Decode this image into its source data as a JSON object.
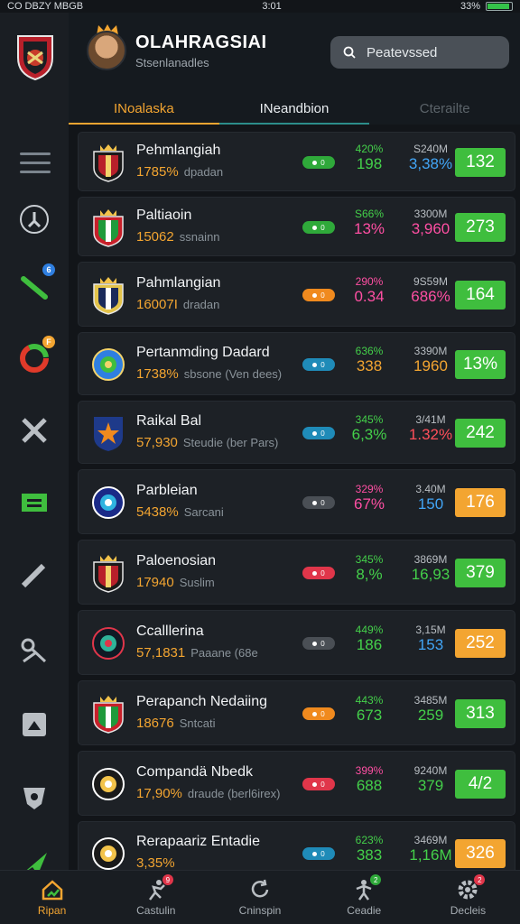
{
  "status_bar": {
    "left": "CO DBZY MBGB",
    "time": "3:01",
    "battery": "33%"
  },
  "header": {
    "title": "OLAHRAGSIAI",
    "subtitle": "Stsenlanadles",
    "search_placeholder": "Peatevssed"
  },
  "tabs": [
    {
      "label": "INoalaska"
    },
    {
      "label": "INeandbion"
    },
    {
      "label": "Cterailte"
    }
  ],
  "sidebar": {
    "items": [
      {
        "icon": "dashboard-icon"
      },
      {
        "icon": "pencil-icon",
        "badge": "6",
        "badge_color": "#2f7fe0"
      },
      {
        "icon": "donut-icon",
        "badge": "F",
        "badge_color": "#f3a531"
      },
      {
        "icon": "tools-icon"
      },
      {
        "icon": "table-icon"
      },
      {
        "icon": "wrench-icon"
      },
      {
        "icon": "link-icon"
      },
      {
        "icon": "box-icon"
      },
      {
        "icon": "shield-icon"
      },
      {
        "icon": "plane-icon"
      }
    ]
  },
  "teams": [
    {
      "name": "Pehmlangiah",
      "value": "1785%",
      "tag": "dpadan",
      "pill_color": "#2fa93a",
      "pill": "0",
      "s1_top": "420%",
      "s1_top_color": "#44d04a",
      "s1_bot": "198",
      "s1_bot_color": "#44d04a",
      "s2_top": "S240M",
      "s2_bot": "3,38%",
      "s2_bot_color": "#42a5f5",
      "score": "132",
      "score_type": "green",
      "crest": "red"
    },
    {
      "name": "Paltiaoin",
      "value": "15062",
      "tag": "ssnainn",
      "pill_color": "#2fa93a",
      "pill": "0",
      "s1_top": "S66%",
      "s1_top_color": "#44d04a",
      "s1_bot": "13%",
      "s1_bot_color": "#ff4fa3",
      "s2_top": "3300M",
      "s2_bot": "3,960",
      "s2_bot_color": "#ff4fa3",
      "score": "273",
      "score_type": "green",
      "crest": "green"
    },
    {
      "name": "Pahmlangian",
      "value": "16007I",
      "tag": "dradan",
      "pill_color": "#f08a1e",
      "pill": "0",
      "s1_top": "290%",
      "s1_top_color": "#ff4fa3",
      "s1_bot": "0.34",
      "s1_bot_color": "#ff4fa3",
      "s2_top": "9S59M",
      "s2_bot": "686%",
      "s2_bot_color": "#ff4fa3",
      "score": "164",
      "score_type": "green",
      "crest": "navy"
    },
    {
      "name": "Pertanmding Dadard",
      "value": "1738%",
      "tag": "sbsone (Ven dees)",
      "pill_color": "#1f8bb8",
      "pill": "0",
      "s1_top": "636%",
      "s1_top_color": "#44d04a",
      "s1_bot": "338",
      "s1_bot_color": "#f3a531",
      "s2_top": "3390M",
      "s2_bot": "1960",
      "s2_bot_color": "#f3a531",
      "score": "13%",
      "score_type": "green",
      "crest": "round"
    },
    {
      "name": "Raikal Bal",
      "value": "57,930",
      "tag": "Steudie (ber Pars)",
      "pill_color": "#1f8bb8",
      "pill": "0",
      "s1_top": "345%",
      "s1_top_color": "#44d04a",
      "s1_bot": "6,3%",
      "s1_bot_color": "#44d04a",
      "s2_top": "3/41M",
      "s2_bot": "1.32%",
      "s2_bot_color": "#ff4f5a",
      "score": "242",
      "score_type": "green",
      "crest": "star"
    },
    {
      "name": "Parbleian",
      "value": "5438%",
      "tag": "Sarcani",
      "pill_color": "#4a4f55",
      "pill": "0",
      "s1_top": "329%",
      "s1_top_color": "#ff4fa3",
      "s1_bot": "67%",
      "s1_bot_color": "#ff4fa3",
      "s2_top": "3.40M",
      "s2_bot": "150",
      "s2_bot_color": "#42a5f5",
      "score": "176",
      "score_type": "orange",
      "crest": "blue"
    },
    {
      "name": "Paloenosian",
      "value": "17940",
      "tag": "Suslim",
      "pill_color": "#e0364a",
      "pill": "0",
      "s1_top": "345%",
      "s1_top_color": "#44d04a",
      "s1_bot": "8,%",
      "s1_bot_color": "#44d04a",
      "s2_top": "3869M",
      "s2_bot": "16,93",
      "s2_bot_color": "#44d04a",
      "score": "379",
      "score_type": "green",
      "crest": "red"
    },
    {
      "name": "Ccalllerina",
      "value": "57,1831",
      "tag": "Paaane (68e",
      "pill_color": "#4a4f55",
      "pill": "0",
      "s1_top": "449%",
      "s1_top_color": "#44d04a",
      "s1_bot": "186",
      "s1_bot_color": "#44d04a",
      "s2_top": "3,15M",
      "s2_bot": "153",
      "s2_bot_color": "#42a5f5",
      "score": "252",
      "score_type": "orange",
      "crest": "dark"
    },
    {
      "name": "Perapanch Nedaiing",
      "value": "18676",
      "tag": "Sntcati",
      "pill_color": "#f08a1e",
      "pill": "0",
      "s1_top": "443%",
      "s1_top_color": "#44d04a",
      "s1_bot": "673",
      "s1_bot_color": "#44d04a",
      "s2_top": "3485M",
      "s2_bot": "259",
      "s2_bot_color": "#44d04a",
      "score": "313",
      "score_type": "green",
      "crest": "green"
    },
    {
      "name": "Compandä Nbedk",
      "value": "17,90%",
      "tag": "draude (berl6irex)",
      "pill_color": "#e0364a",
      "pill": "0",
      "s1_top": "399%",
      "s1_top_color": "#ff4fa3",
      "s1_bot": "688",
      "s1_bot_color": "#44d04a",
      "s2_top": "9240M",
      "s2_bot": "379",
      "s2_bot_color": "#44d04a",
      "score": "4/2",
      "score_type": "green",
      "crest": "gold"
    },
    {
      "name": "Rerapaariz Entadie",
      "value": "3,35%",
      "tag": "",
      "pill_color": "#1f8bb8",
      "pill": "0",
      "s1_top": "623%",
      "s1_top_color": "#44d04a",
      "s1_bot": "383",
      "s1_bot_color": "#44d04a",
      "s2_top": "3469M",
      "s2_bot": "1,16M",
      "s2_bot_color": "#44d04a",
      "score": "326",
      "score_type": "orange",
      "crest": "gold"
    }
  ],
  "bottom_nav": [
    {
      "label": "Ripan",
      "icon": "home-icon",
      "active": true
    },
    {
      "label": "Castulin",
      "icon": "runner-icon",
      "badge": "9",
      "badge_color": "#e0364a"
    },
    {
      "label": "Cninspin",
      "icon": "refresh-icon"
    },
    {
      "label": "Ceadie",
      "icon": "player-icon",
      "badge": "2",
      "badge_color": "#2fa93a"
    },
    {
      "label": "Decleis",
      "icon": "settings-icon",
      "badge": "2",
      "badge_color": "#e0364a"
    }
  ]
}
